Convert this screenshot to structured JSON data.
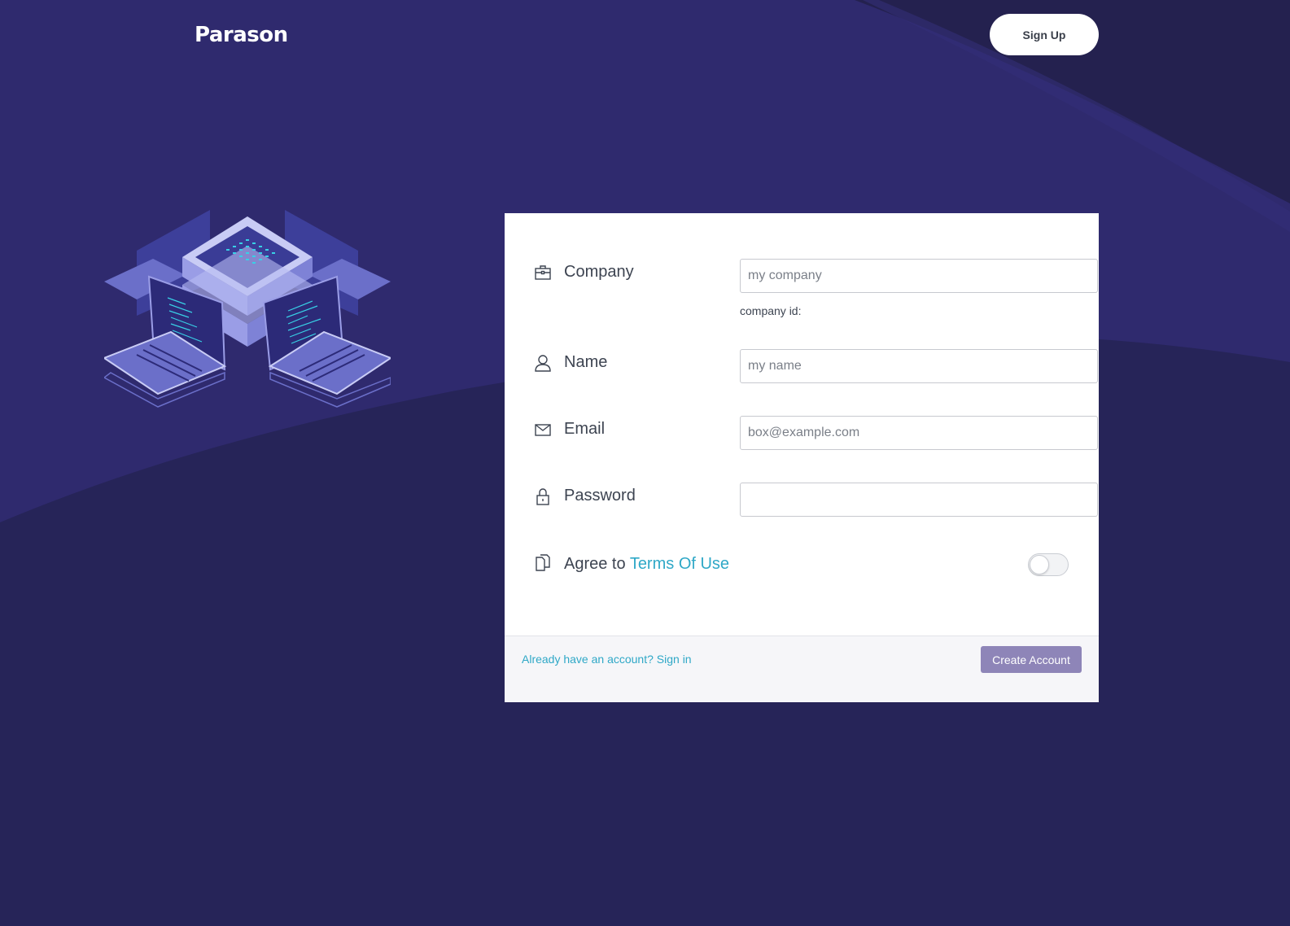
{
  "header": {
    "logo_text": "Parason",
    "signup_label": "Sign Up"
  },
  "illustration": {
    "icon": "isometric-server-laptops-illustration"
  },
  "form": {
    "company": {
      "label": "Company",
      "placeholder": "my company",
      "helper": "company id:",
      "icon": "briefcase-icon"
    },
    "name": {
      "label": "Name",
      "placeholder": "my name",
      "icon": "user-icon"
    },
    "email": {
      "label": "Email",
      "placeholder": "box@example.com",
      "icon": "envelope-icon"
    },
    "password": {
      "label": "Password",
      "placeholder": "",
      "icon": "lock-icon"
    },
    "terms": {
      "prefix": "Agree to ",
      "link_text": "Terms Of Use",
      "checked": false,
      "icon": "document-icon"
    }
  },
  "footer": {
    "signin_link": "Already have an account? Sign in",
    "create_label": "Create Account"
  },
  "colors": {
    "background": "#262458",
    "wave_light": "#2f2a6e",
    "accent_link": "#2fa8c7",
    "primary_button": "#8e85b8"
  }
}
